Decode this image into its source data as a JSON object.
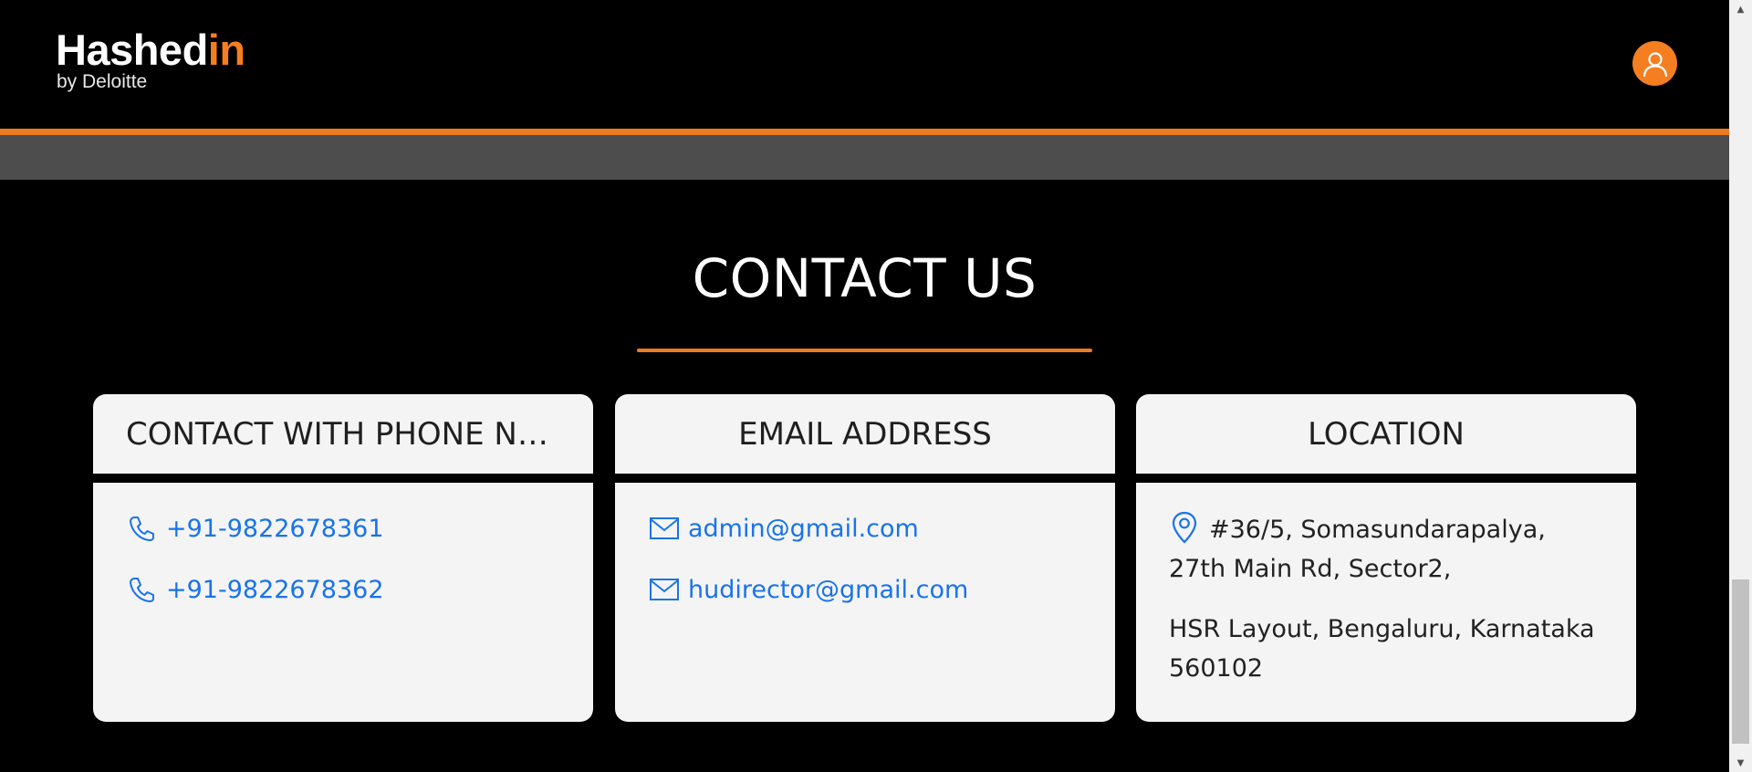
{
  "header": {
    "logo_text_main": "Hashed",
    "logo_text_accent": "in",
    "logo_subtitle": "by Deloitte",
    "avatar_icon": "user-icon"
  },
  "colors": {
    "accent": "#f47e20",
    "link": "#1a73e8",
    "card_bg": "#f4f4f4",
    "band_gray": "#4d4d4d"
  },
  "contact": {
    "title": "CONTACT US",
    "cards": [
      {
        "heading": "CONTACT WITH PHONE NU...",
        "icon": "phone-icon",
        "items": [
          "+91-9822678361",
          "+91-9822678362"
        ]
      },
      {
        "heading": "EMAIL ADDRESS",
        "icon": "mail-icon",
        "items": [
          "admin@gmail.com",
          "hudirector@gmail.com"
        ]
      },
      {
        "heading": "LOCATION",
        "icon": "map-pin-icon",
        "address_line1": "#36/5, Somasundarapalya, 27th Main Rd, Sector2,",
        "address_line2": "HSR Layout, Bengaluru, Karnataka 560102"
      }
    ]
  }
}
